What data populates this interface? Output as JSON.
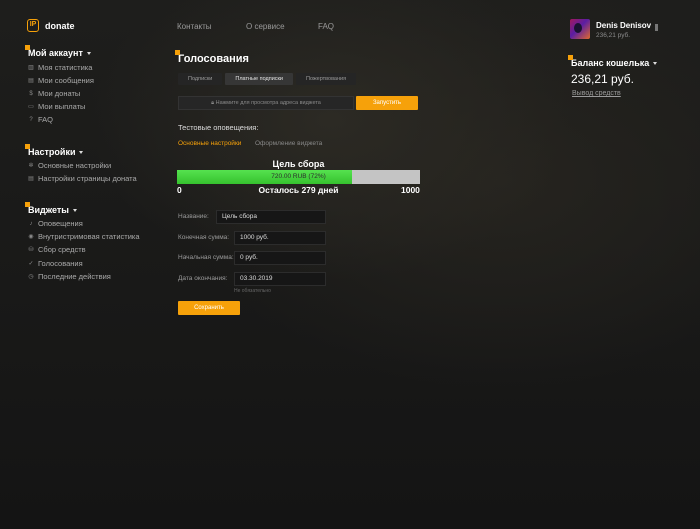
{
  "brand": {
    "name": "donate",
    "mark": "IP"
  },
  "topnav": [
    "Контакты",
    "О сервисе",
    "FAQ"
  ],
  "user": {
    "name": "Denis Denisov",
    "balance": "236,21 руб."
  },
  "sidebar": {
    "account": {
      "title": "Мой аккаунт",
      "items": [
        "Моя статистика",
        "Мои сообщения",
        "Мои донаты",
        "Мои выплаты",
        "FAQ"
      ]
    },
    "settings": {
      "title": "Настройки",
      "items": [
        "Основные настройки",
        "Настройки страницы доната"
      ]
    },
    "widgets": {
      "title": "Виджеты",
      "items": [
        "Оповещения",
        "Внутристримовая статистика",
        "Сбор средств",
        "Голосования",
        "Последние действия"
      ]
    }
  },
  "main": {
    "title": "Голосования",
    "tabs": [
      "Подписки",
      "Платные подписки",
      "Пожертвования"
    ],
    "active_tab": 1,
    "url_placeholder": "Нажмите для просмотра адреса виджета",
    "launch_label": "Запустить",
    "test_label": "Тестовые оповещения:",
    "subtabs": [
      "Основные настройки",
      "Оформление виджета"
    ],
    "goal": {
      "title": "Цель сбора",
      "progress_text": "720.00 RUB (72%)",
      "progress_fraction": 0.72,
      "min": "0",
      "max": "1000",
      "remaining": "Осталось 279 дней"
    },
    "form": {
      "name_label": "Название:",
      "name_value": "Цель сбора",
      "end_sum_label": "Конечная сумма:",
      "end_sum_value": "1000 руб.",
      "start_sum_label": "Начальная сумма:",
      "start_sum_value": "0 руб.",
      "end_date_label": "Дата окончания:",
      "end_date_value": "03.30.2019",
      "end_date_hint": "Не обязательно",
      "save_label": "Сохранить"
    }
  },
  "wallet": {
    "title": "Баланс кошелька",
    "amount": "236,21 руб.",
    "withdraw": "Вывод средств"
  },
  "colors": {
    "accent": "#f6a10a",
    "progress": "#3fd136"
  }
}
